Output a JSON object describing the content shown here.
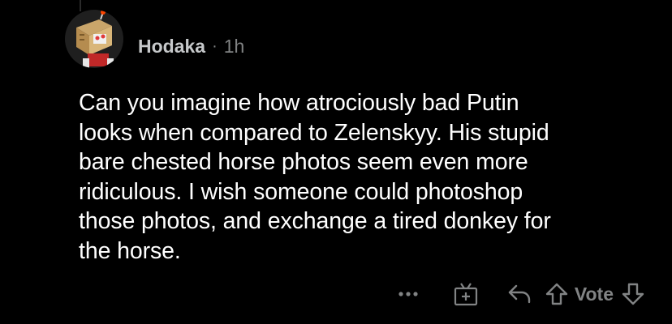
{
  "comment": {
    "author": "Hodaka",
    "separator": "·",
    "time": "1h",
    "body": "Can you imagine how atrociously bad Putin\nlooks when compared to Zelenskyy. His stupid\nbare chested horse photos seem even more\nridiculous. I wish someone could photoshop\nthose photos, and exchange a tired donkey for\nthe horse.",
    "vote_label": "Vote"
  },
  "icons": {
    "avatar": "box-robot-avatar",
    "more": "more-horizontal-icon",
    "award": "award-gift-icon",
    "reply": "reply-arrow-icon",
    "upvote": "upvote-arrow-icon",
    "downvote": "downvote-arrow-icon"
  },
  "colors": {
    "background": "#000000",
    "body_text": "#ffffff",
    "muted": "#818384"
  }
}
